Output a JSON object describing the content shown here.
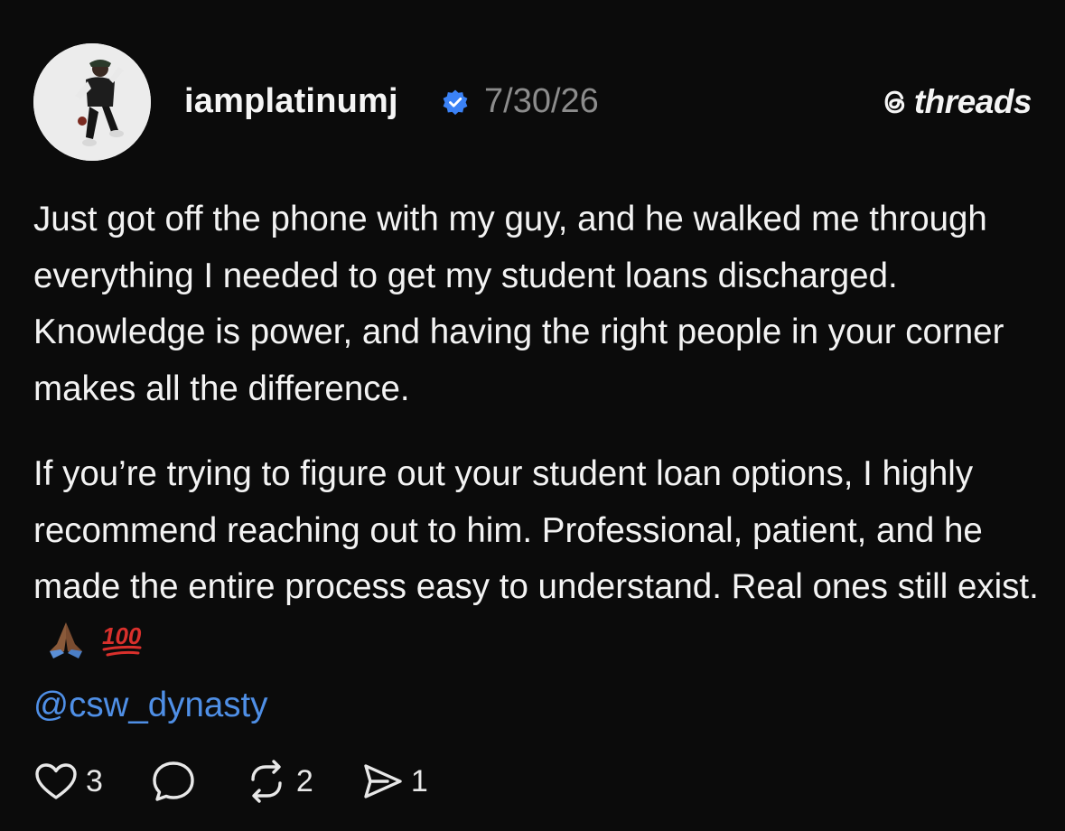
{
  "post": {
    "username": "iamplatinumj",
    "date": "7/30/26",
    "paragraph_1": "Just got off the phone with my guy, and he walked me through everything I needed to get my student loans discharged. Knowledge is power, and having the right people in your corner makes all the difference.",
    "paragraph_2": "If you’re trying to figure out your student loan options, I highly recommend reaching out to him. Professional, patient, and he made the entire process easy to understand. Real ones still exist.",
    "emojis": [
      "folded-hands-medium-dark-skin",
      "hundred-points"
    ],
    "mention": "@csw_dynasty"
  },
  "brand": {
    "name": "threads",
    "icon": "threads-logo-icon"
  },
  "actions": {
    "likes": "3",
    "comments": "",
    "reposts": "2",
    "shares": "1"
  },
  "colors": {
    "background": "#0b0b0b",
    "text": "#f3f3f3",
    "muted": "#8c8c8c",
    "link": "#4f8fe6",
    "verified": "#3b82f6"
  }
}
